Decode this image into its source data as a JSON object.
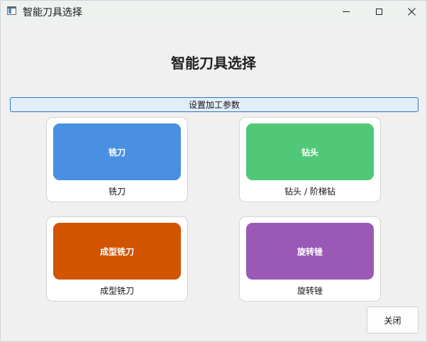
{
  "window": {
    "title": "智能刀具选择",
    "controls": {
      "minimize_icon": "minimize-icon",
      "maximize_icon": "maximize-icon",
      "close_icon": "close-icon"
    }
  },
  "main": {
    "heading": "智能刀具选择",
    "params_button": "设置加工参数",
    "tools": [
      {
        "tile_label": "铣刀",
        "caption": "铣刀",
        "color": "#4a90e2"
      },
      {
        "tile_label": "钻头",
        "caption": "钻头 / 阶梯钻",
        "color": "#50c878"
      },
      {
        "tile_label": "成型铣刀",
        "caption": "成型铣刀",
        "color": "#d35400"
      },
      {
        "tile_label": "旋转锉",
        "caption": "旋转锉",
        "color": "#9b59b6"
      }
    ],
    "close_button": "关闭"
  }
}
